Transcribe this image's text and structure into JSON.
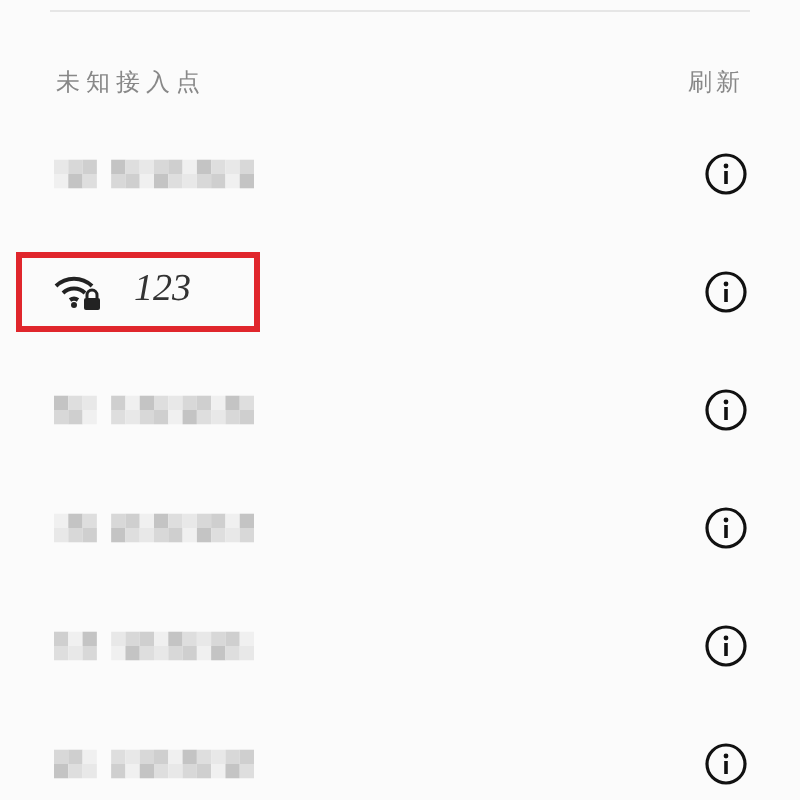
{
  "section": {
    "title": "未知接入点",
    "action": "刷新"
  },
  "networks": [
    {
      "kind": "redacted",
      "highlighted": false
    },
    {
      "kind": "network",
      "name": "123",
      "highlighted": true
    },
    {
      "kind": "redacted",
      "highlighted": false
    },
    {
      "kind": "redacted",
      "highlighted": false
    },
    {
      "kind": "redacted",
      "highlighted": false
    },
    {
      "kind": "redacted",
      "highlighted": false
    }
  ]
}
